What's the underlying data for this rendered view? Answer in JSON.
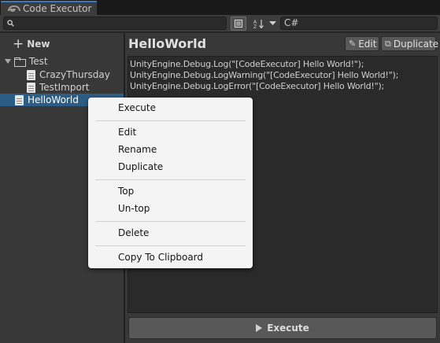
{
  "window": {
    "tab_title": "Code Executor"
  },
  "toolbar": {
    "search_value": "",
    "language": "C#"
  },
  "sidebar": {
    "new_label": "New",
    "tree": [
      {
        "label": "Test",
        "type": "folder",
        "expanded": true
      },
      {
        "label": "CrazyThursday",
        "type": "file"
      },
      {
        "label": "TestImport",
        "type": "file"
      },
      {
        "label": "HelloWorld",
        "type": "file",
        "selected": true
      }
    ]
  },
  "editor": {
    "title": "HelloWorld",
    "edit_label": "Edit",
    "duplicate_label": "Duplicate",
    "code_lines": [
      "UnityEngine.Debug.Log(\"[CodeExecutor] Hello World!\");",
      "UnityEngine.Debug.LogWarning(\"[CodeExecutor] Hello World!\");",
      "UnityEngine.Debug.LogError(\"[CodeExecutor] Hello World!\");"
    ],
    "execute_label": "Execute"
  },
  "context_menu": {
    "items": [
      "Execute",
      "Edit",
      "Rename",
      "Duplicate",
      "Top",
      "Un-top",
      "Delete",
      "Copy To Clipboard"
    ]
  },
  "colors": {
    "selection": "#2c5d87",
    "tab_accent": "#3a79bb",
    "menu_bg": "#f4f4f4"
  }
}
